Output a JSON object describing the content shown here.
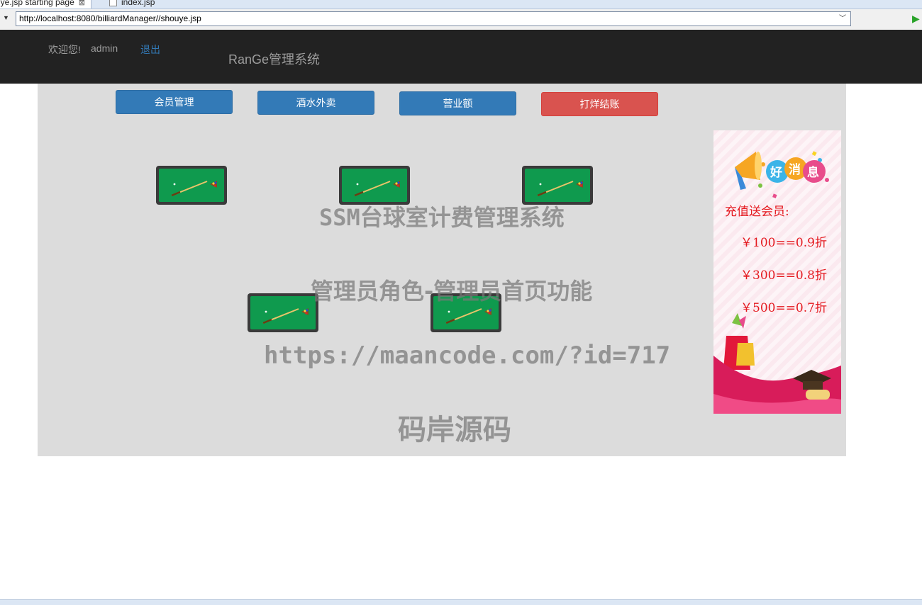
{
  "ide": {
    "tabs": [
      {
        "label": "uye.jsp  starting page",
        "close": "⊠"
      },
      {
        "label": "index.jsp"
      }
    ]
  },
  "browser": {
    "url": "http://localhost:8080/billiardManager//shouye.jsp"
  },
  "navbar": {
    "welcome": "欢迎您!",
    "username": "admin",
    "logout": "退出",
    "brand": "RanGe管理系统"
  },
  "toolbar": {
    "buttons": [
      "会员管理",
      "酒水外卖",
      "营业额",
      "打烊结账"
    ]
  },
  "tables_count": 5,
  "watermark": {
    "line1": "SSM台球室计费管理系统",
    "line2": "管理员角色-管理员首页功能",
    "line3": "https://maancode.com/?id=717",
    "line4": "码岸源码"
  },
  "promo": {
    "badge": [
      "好",
      "消",
      "息"
    ],
    "lead": "充值送会员:",
    "offers": [
      "￥100==0.9折",
      "￥300==0.8折",
      "￥500==0.7折"
    ]
  },
  "colors": {
    "navbar": "#222222",
    "primary": "#337ab7",
    "danger": "#d9534f",
    "panel": "#dcdcdc",
    "felt": "#0f9a4e",
    "promo_text": "#e4191f"
  }
}
